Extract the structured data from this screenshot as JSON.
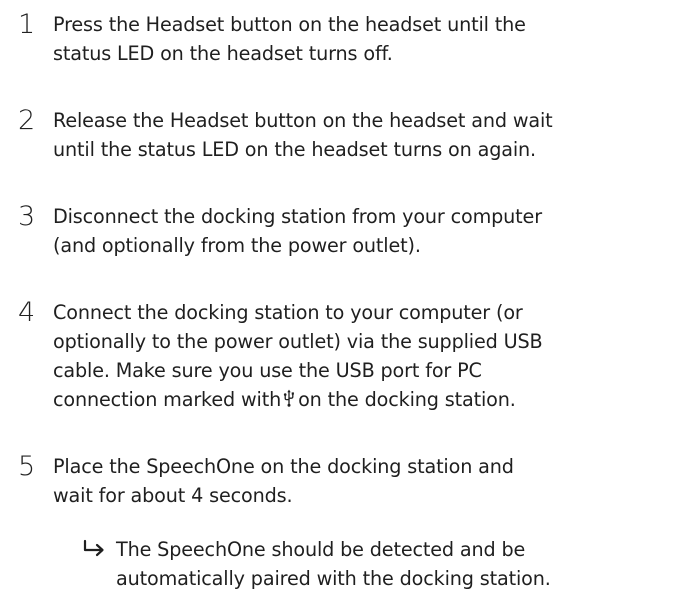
{
  "steps": [
    {
      "number": "1",
      "lines": [
        "Press the Headset button on the headset until the",
        "status LED on the headset turns off."
      ]
    },
    {
      "number": "2",
      "lines": [
        "Release the Headset button on the headset and wait",
        "until the status LED on the headset turns on again."
      ]
    },
    {
      "number": "3",
      "lines": [
        "Disconnect the docking station from your computer",
        "(and optionally from the power outlet)."
      ]
    },
    {
      "number": "4",
      "lines": [
        "Connect the docking station to your computer (or",
        "optionally to the power outlet) via the supplied USB",
        "cable. Make sure you use the USB port for PC"
      ],
      "last_line_before_icon": "connection marked with",
      "icon": "usb-icon",
      "last_line_after_icon": "on the docking station."
    },
    {
      "number": "5",
      "lines": [
        "Place the SpeechOne on the docking station and",
        "wait for about 4 seconds."
      ]
    }
  ],
  "result": {
    "icon": "result-arrow-icon",
    "lines": [
      "The SpeechOne should be detected and be",
      "automatically paired with the docking station."
    ]
  }
}
